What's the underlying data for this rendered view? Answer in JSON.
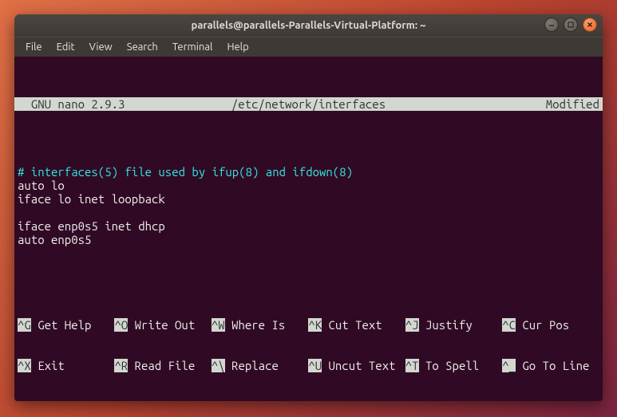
{
  "titlebar": {
    "title": "parallels@parallels-Parallels-Virtual-Platform: ~"
  },
  "menubar": {
    "items": [
      "File",
      "Edit",
      "View",
      "Search",
      "Terminal",
      "Help"
    ]
  },
  "nano": {
    "header_left": "  GNU nano 2.9.3",
    "header_center": "/etc/network/interfaces",
    "header_right": "Modified"
  },
  "editor": {
    "comment_line": "# interfaces(5) file used by ifup(8) and ifdown(8)",
    "lines": [
      "auto lo",
      "iface lo inet loopback",
      "",
      "iface enp0s5 inet dhcp",
      "auto enp0s5"
    ]
  },
  "shortcuts": {
    "row1": [
      {
        "key": "^G",
        "label": "Get Help"
      },
      {
        "key": "^O",
        "label": "Write Out"
      },
      {
        "key": "^W",
        "label": "Where Is"
      },
      {
        "key": "^K",
        "label": "Cut Text"
      },
      {
        "key": "^J",
        "label": "Justify"
      },
      {
        "key": "^C",
        "label": "Cur Pos"
      }
    ],
    "row2": [
      {
        "key": "^X",
        "label": "Exit"
      },
      {
        "key": "^R",
        "label": "Read File"
      },
      {
        "key": "^\\",
        "label": "Replace"
      },
      {
        "key": "^U",
        "label": "Uncut Text"
      },
      {
        "key": "^T",
        "label": "To Spell"
      },
      {
        "key": "^_",
        "label": "Go To Line"
      }
    ]
  }
}
